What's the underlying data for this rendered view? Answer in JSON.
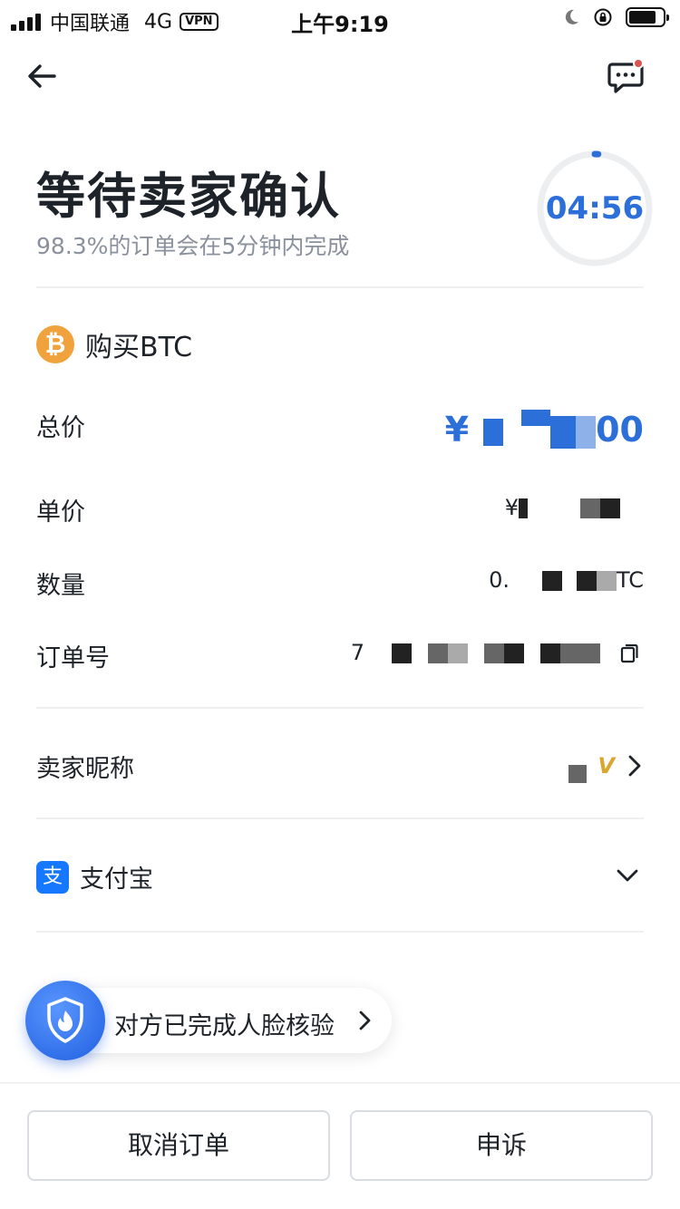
{
  "status_bar": {
    "carrier": "中国联通",
    "network": "4G",
    "vpn": "VPN",
    "time": "上午9:19"
  },
  "header": {
    "title": "等待卖家确认",
    "subtitle": "98.3%的订单会在5分钟内完成",
    "countdown": "04:56",
    "countdown_progress": 0.99
  },
  "coin": {
    "label": "购买BTC",
    "icon_glyph": "₿",
    "icon_color": "#f0a23c"
  },
  "details": {
    "total_label": "总价",
    "total_prefix": "¥",
    "total_suffix": "00",
    "unit_price_label": "单价",
    "unit_price_prefix": "¥",
    "quantity_label": "数量",
    "quantity_prefix": "0.",
    "quantity_suffix": "TC",
    "order_no_label": "订单号",
    "order_no_prefix": "7"
  },
  "seller": {
    "label": "卖家昵称",
    "badge": "V"
  },
  "payment": {
    "icon_glyph": "支",
    "label": "支付宝",
    "icon_color": "#1677ff"
  },
  "face_verification": {
    "text": "对方已完成人脸核验"
  },
  "footer": {
    "cancel_label": "取消订单",
    "appeal_label": "申诉"
  },
  "colors": {
    "accent": "#2c6fd9",
    "text": "#1e2329",
    "muted": "#8a919c"
  }
}
